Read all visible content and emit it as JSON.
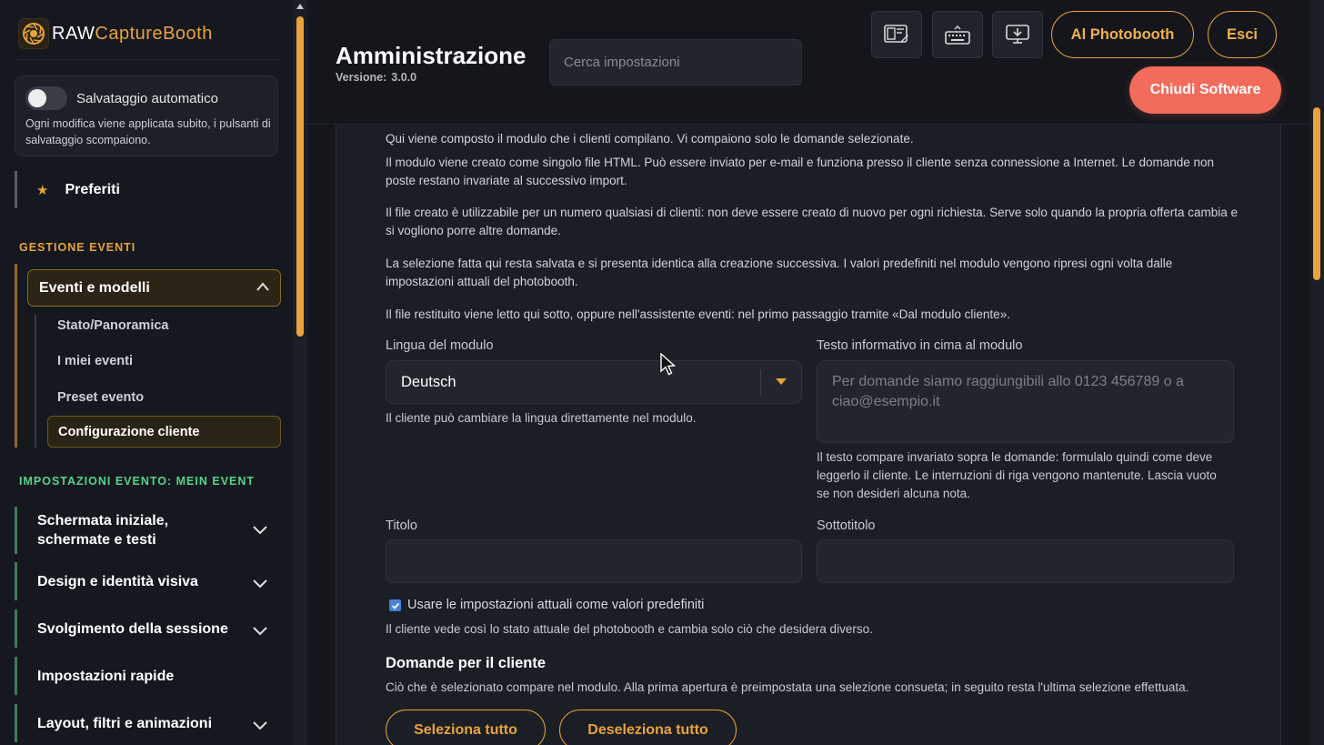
{
  "brand": {
    "prefix": "RAW",
    "highlight": "CaptureBooth"
  },
  "sidebar": {
    "autosave": {
      "label": "Salvataggio automatico",
      "enabled": false,
      "description": "Ogni modifica viene applicata subito, i pulsanti di salvataggio scompaiono."
    },
    "favorites_label": "Preferiti",
    "section_events": "GESTIONE EVENTI",
    "events_group": {
      "label": "Eventi e modelli",
      "items": [
        "Stato/Panoramica",
        "I miei eventi",
        "Preset evento",
        "Configurazione cliente"
      ],
      "active_item": "Configurazione cliente"
    },
    "section_settings": "IMPOSTAZIONI EVENTO: MEIN EVENT",
    "nav_items": [
      {
        "line1": "Schermata iniziale,",
        "line2": "schermate e testi"
      },
      {
        "label": "Design e identità visiva"
      },
      {
        "label": "Svolgimento della sessione"
      },
      {
        "label": "Impostazioni rapide"
      },
      {
        "label": "Layout, filtri e animazioni"
      }
    ]
  },
  "header": {
    "title": "Amministrazione",
    "version_label": "Versione:",
    "version_value": "3.0.0",
    "search_placeholder": "Cerca impostazioni",
    "toolbar_icons": [
      "layout-edit-icon",
      "keyboard-icon",
      "monitor-download-icon"
    ],
    "to_photobooth": "Al Photobooth",
    "exit": "Esci",
    "close_software": "Chiudi Software"
  },
  "content": {
    "paragraphs": [
      "Qui viene composto il modulo che i clienti compilano. Vi compaiono solo le domande selezionate.",
      "Il modulo viene creato come singolo file HTML. Può essere inviato per e-mail e funziona presso il cliente senza connessione a Internet. Le domande non poste restano invariate al successivo import.",
      "Il file creato è utilizzabile per un numero qualsiasi di clienti: non deve essere creato di nuovo per ogni richiesta. Serve solo quando la propria offerta cambia e si vogliono porre altre domande.",
      "La selezione fatta qui resta salvata e si presenta identica alla creazione successiva. I valori predefiniti nel modulo vengono ripresi ogni volta dalle impostazioni attuali del photobooth.",
      "Il file restituito viene letto qui sotto, oppure nell'assistente eventi: nel primo passaggio tramite «Dal modulo cliente»."
    ],
    "language": {
      "label": "Lingua del modulo",
      "value": "Deutsch",
      "hint": "Il cliente può cambiare la lingua direttamente nel modulo."
    },
    "info_text": {
      "label": "Testo informativo in cima al modulo",
      "placeholder": "Per domande siamo raggiungibili allo 0123 456789 o a ciao@esempio.it",
      "hint": "Il testo compare invariato sopra le domande: formulalo quindi come deve leggerlo il cliente. Le interruzioni di riga vengono mantenute. Lascia vuoto se non desideri alcuna nota."
    },
    "title_field": {
      "label": "Titolo",
      "value": ""
    },
    "subtitle_field": {
      "label": "Sottotitolo",
      "value": ""
    },
    "defaults": {
      "checked": true,
      "label": "Usare le impostazioni attuali come valori predefiniti",
      "hint": "Il cliente vede così lo stato attuale del photobooth e cambia solo ciò che desidera diverso."
    },
    "questions": {
      "title": "Domande per il cliente",
      "hint": "Ciò che è selezionato compare nel modulo. Alla prima apertura è preimpostata una selezione consueta; in seguito resta l'ultima selezione effettuata.",
      "select_all": "Seleziona tutto",
      "deselect_all": "Deseleziona tutto"
    }
  },
  "colors": {
    "accent": "#e8a33a",
    "danger": "#f26b5b",
    "section_green": "#56d38b",
    "background": "#14161c"
  }
}
